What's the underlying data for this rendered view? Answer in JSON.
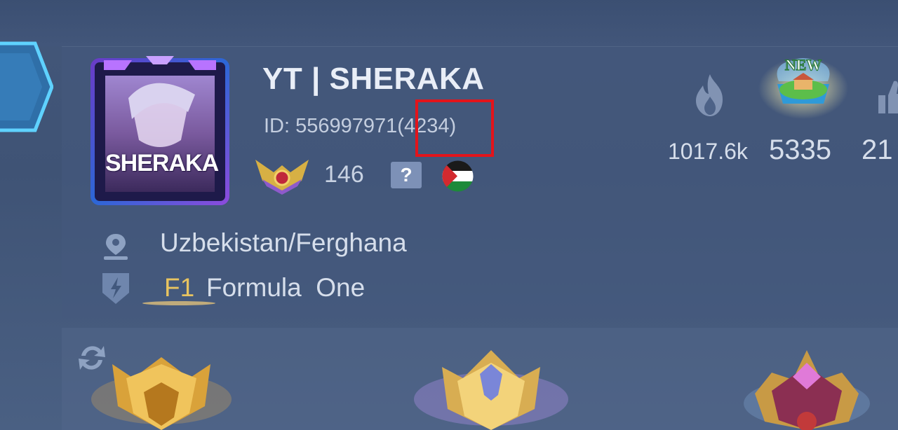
{
  "player": {
    "name": "YT | SHERAKA",
    "id_label": "ID:",
    "id_number": "556997971",
    "server": "(4234)",
    "avatar_label": "SHERAKA",
    "rank_points": "146",
    "help_badge": "?"
  },
  "location": {
    "text": "Uzbekistan/Ferghana"
  },
  "squad": {
    "tag": "F1",
    "name": "Formula  One"
  },
  "stats": {
    "popularity": "1017.6k",
    "island_badge": "NEW",
    "island_value": "5335",
    "likes": "21"
  },
  "icons": {
    "location": "location-pin-icon",
    "squad": "squad-shield-icon",
    "popularity": "flame-icon",
    "likes": "thumbs-up-icon",
    "swap": "refresh-icon",
    "flag": "palestine-flag-icon"
  },
  "colors": {
    "highlight": "#e3141b",
    "squad_tag": "#e8c460",
    "text_primary": "#e9eef7",
    "panel": "#465a7d"
  }
}
